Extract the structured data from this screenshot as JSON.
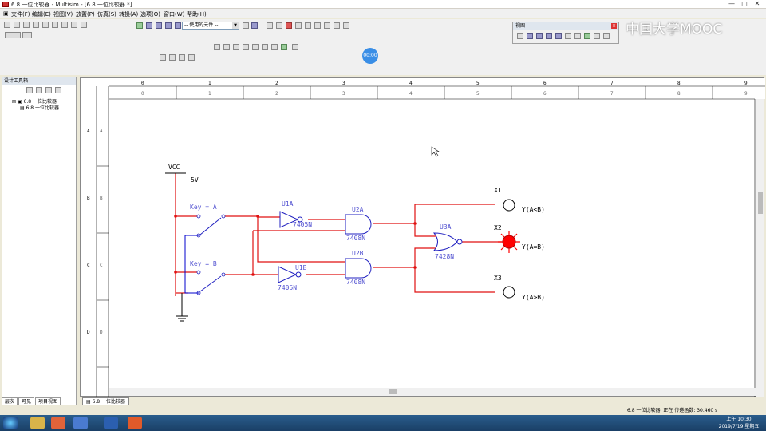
{
  "window": {
    "title": "6.8 一位比较器 - Multisim - [6.8 一位比较器 *]",
    "controls": [
      "—",
      "□",
      "✕"
    ]
  },
  "menu": [
    "文件(F)",
    "编辑(E)",
    "视图(V)",
    "放置(P)",
    "仿真(S)",
    "转换(A)",
    "选项(O)",
    "窗口(W)",
    "帮助(H)"
  ],
  "toolbar": {
    "component_combo": "-- 使用的元件 --",
    "view_panel_title": "视图"
  },
  "watermark": "中国大学MOOC",
  "timer": "00:00",
  "design_toolbox": {
    "title": "设计工具箱",
    "tree_root": "6.8 一位比较器",
    "tree_child": "6.8 一位比较器",
    "tabs": [
      "层次",
      "可见",
      "项目视图"
    ]
  },
  "ruler": {
    "columns": [
      "0",
      "1",
      "2",
      "3",
      "4",
      "5",
      "6",
      "7",
      "8",
      "9"
    ],
    "rows": [
      "A",
      "B",
      "C",
      "D"
    ]
  },
  "circuit": {
    "vcc_label": "VCC",
    "vcc_value": "5V",
    "switch_a": "Key = A",
    "switch_b": "Key = B",
    "inv_a_ref": "U1A",
    "inv_a_part": "7405N",
    "inv_b_ref": "U1B",
    "inv_b_part": "7405N",
    "and_a_ref": "U2A",
    "and_a_part": "7408N",
    "and_b_ref": "U2B",
    "and_b_part": "7408N",
    "nor_ref": "U3A",
    "nor_part": "7428N",
    "probe1_ref": "X1",
    "probe1_label": "Y(A<B)",
    "probe2_ref": "X2",
    "probe2_label": "Y(A=B)",
    "probe3_ref": "X3",
    "probe3_label": "Y(A>B)",
    "active_probe": "X2"
  },
  "colors": {
    "wire_active": "#e01010",
    "wire_idle": "#0000cc",
    "component": "#2020c0",
    "label": "#5050d0",
    "probe_lit": "#ff0000"
  },
  "document_tab": "6.8 一位比较器",
  "status": {
    "sheet": "6.8 一位比较器: 正在",
    "sim_time": "传递函数: 30.460 s"
  },
  "clock": {
    "time": "上午 10:30",
    "date": "2019/7/19 星期五"
  }
}
